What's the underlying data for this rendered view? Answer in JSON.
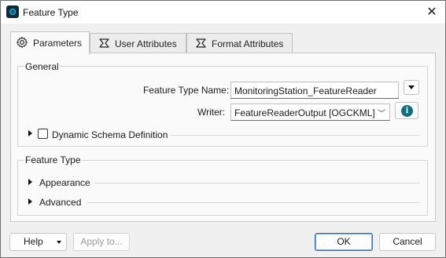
{
  "window": {
    "title": "Feature Type",
    "close_glyph": "✕",
    "app_icon": "fme-app-icon"
  },
  "tabs": [
    {
      "label": "Parameters",
      "icon": "gear-icon",
      "active": true
    },
    {
      "label": "User Attributes",
      "icon": "sigma-icon",
      "active": false
    },
    {
      "label": "Format Attributes",
      "icon": "sigma-icon",
      "active": false
    }
  ],
  "general": {
    "title": "General",
    "feature_type_name_label": "Feature Type Name:",
    "feature_type_name_value": "MonitoringStation_FeatureReader",
    "writer_label": "Writer:",
    "writer_value": "FeatureReaderOutput [OGCKML]",
    "info_glyph": "i",
    "dynamic_schema_label": "Dynamic Schema Definition",
    "dynamic_schema_checked": false
  },
  "feature_type_group": {
    "title": "Feature Type",
    "appearance_label": "Appearance",
    "advanced_label": "Advanced"
  },
  "footer": {
    "help_label": "Help",
    "apply_label": "Apply to...",
    "ok_label": "OK",
    "cancel_label": "Cancel"
  },
  "colors": {
    "accent": "#1f6fc5",
    "info": "#0f6f7f"
  }
}
